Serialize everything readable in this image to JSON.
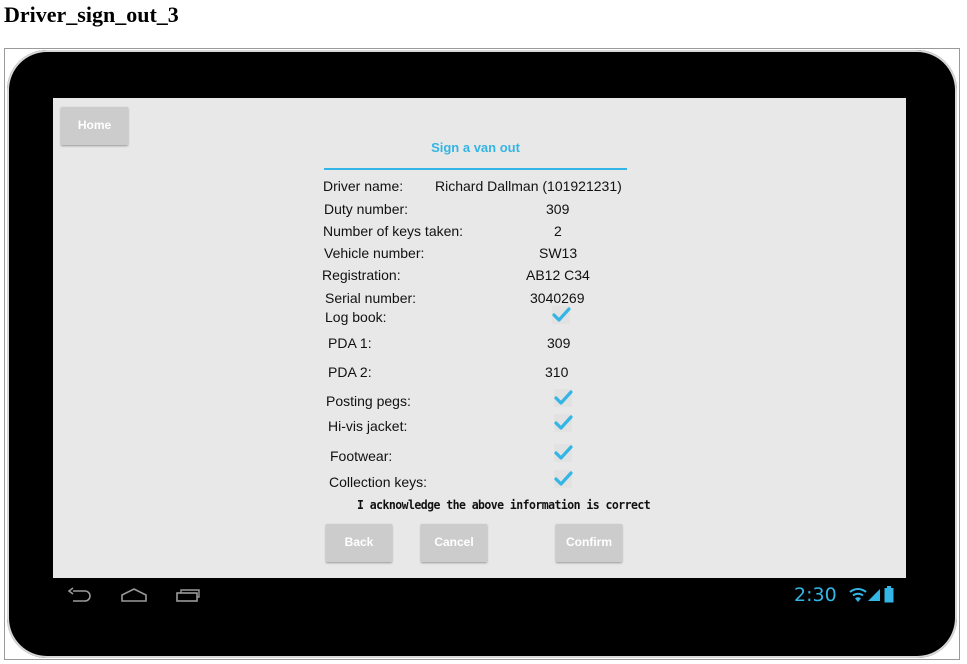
{
  "page": {
    "heading": "Driver_sign_out_3"
  },
  "app": {
    "home_label": "Home",
    "title": "Sign a van out",
    "fields": [
      {
        "label": "Driver name:",
        "value": "Richard Dallman (101921231)"
      },
      {
        "label": "Duty number:",
        "value": "309"
      },
      {
        "label": "Number of keys taken:",
        "value": "2"
      },
      {
        "label": "Vehicle number:",
        "value": "SW13"
      },
      {
        "label": "Registration:",
        "value": "AB12 C34"
      },
      {
        "label": "Serial number:",
        "value": "3040269"
      },
      {
        "label": "Log book:",
        "checked": true
      },
      {
        "label": "PDA 1:",
        "value": "309"
      },
      {
        "label": "PDA 2:",
        "value": "310"
      },
      {
        "label": "Posting pegs:",
        "checked": true
      },
      {
        "label": "Hi-vis jacket:",
        "checked": true
      },
      {
        "label": "Footwear:",
        "checked": true
      },
      {
        "label": "Collection keys:",
        "checked": true
      }
    ],
    "acknowledgement": "I acknowledge the above information is correct",
    "buttons": {
      "back": "Back",
      "cancel": "Cancel",
      "confirm": "Confirm"
    }
  },
  "statusbar": {
    "time": "2:30"
  },
  "colors": {
    "accent": "#33b5e5",
    "button": "#cccccc",
    "screen_bg": "#e8e8e8"
  }
}
